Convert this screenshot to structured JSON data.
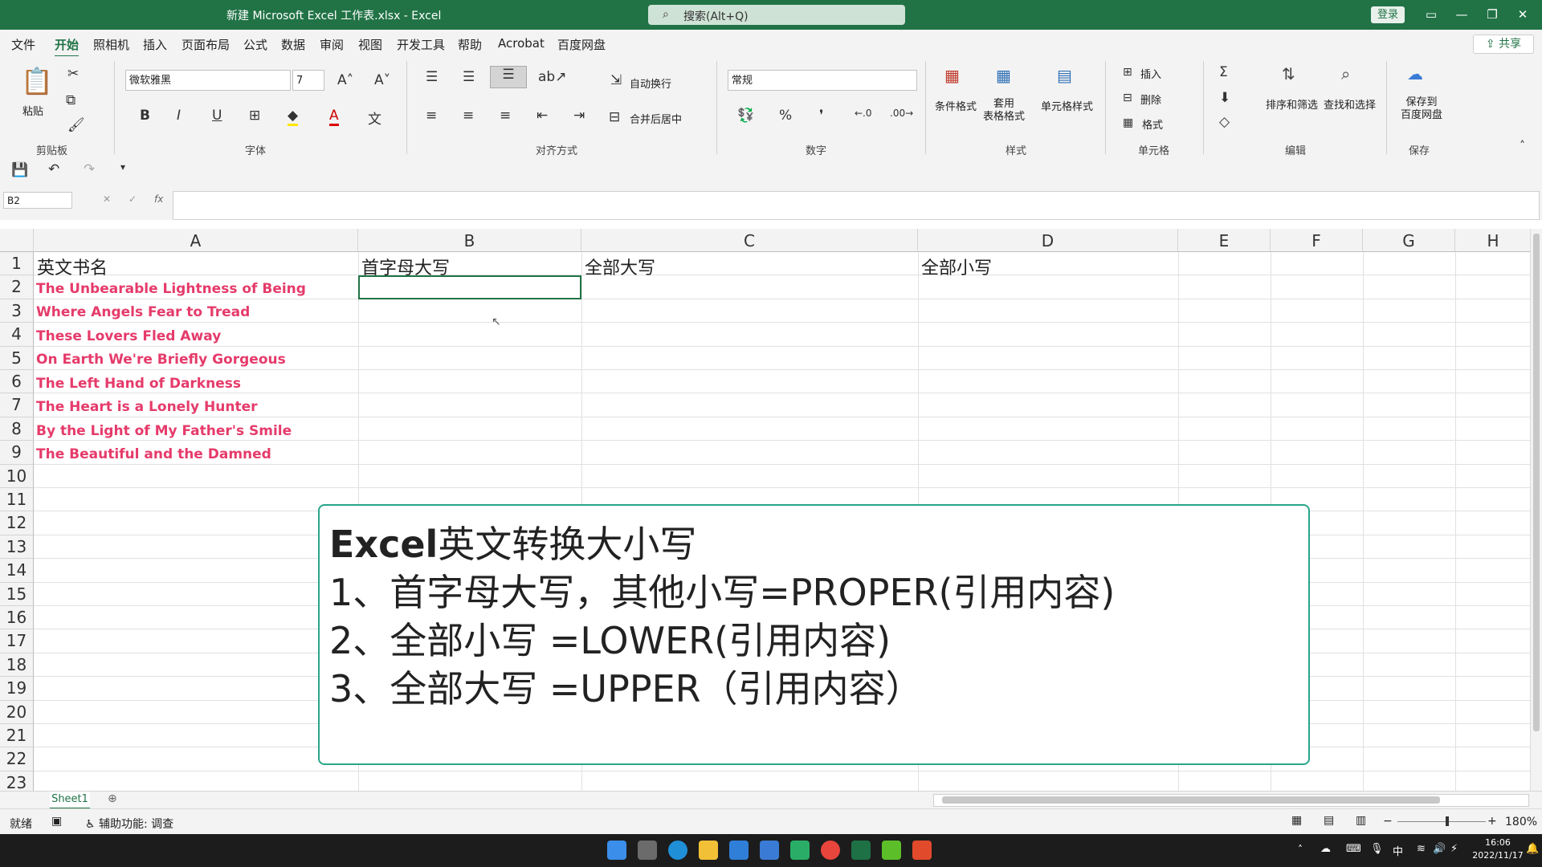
{
  "titlebar": {
    "title": "新建 Microsoft Excel 工作表.xlsx  -  Excel",
    "search_placeholder": "搜索(Alt+Q)",
    "login": "登录"
  },
  "menu": [
    "文件",
    "开始",
    "照相机",
    "插入",
    "页面布局",
    "公式",
    "数据",
    "审阅",
    "视图",
    "开发工具",
    "帮助",
    "Acrobat",
    "百度网盘"
  ],
  "share": "共享",
  "ribbon": {
    "paste": "粘贴",
    "font_name": "微软雅黑",
    "font_size": "7",
    "wrap_text": "自动换行",
    "merge_center": "合并后居中",
    "number_format": "常规",
    "cond_format": "条件格式",
    "table_format": "套用\n表格格式",
    "cell_styles": "单元格样式",
    "insert": "插入",
    "delete": "删除",
    "format": "格式",
    "sort_filter": "排序和筛选",
    "find_select": "查找和选择",
    "save_to": "保存到\n百度网盘",
    "groups": [
      "剪贴板",
      "字体",
      "对齐方式",
      "数字",
      "样式",
      "单元格",
      "编辑",
      "保存"
    ]
  },
  "name_box": "B2",
  "columns": [
    "A",
    "B",
    "C",
    "D",
    "E",
    "F",
    "G",
    "H"
  ],
  "rows": [
    "1",
    "2",
    "3",
    "4",
    "5",
    "6",
    "7",
    "8",
    "9",
    "10",
    "11",
    "12",
    "13",
    "14",
    "15",
    "16",
    "17",
    "18",
    "19",
    "20",
    "21",
    "22",
    "23"
  ],
  "headers": {
    "a1": "英文书名",
    "b1": "首字母大写",
    "c1": "全部大写",
    "d1": "全部小写"
  },
  "books": [
    "The Unbearable Lightness of Being",
    "Where Angels Fear to Tread",
    "These Lovers Fled Away",
    "On Earth We're Briefly Gorgeous",
    "The Left Hand of Darkness",
    "The Heart is a Lonely Hunter",
    "By the Light of My Father's Smile",
    "The Beautiful and the Damned"
  ],
  "note": {
    "line1_bold": "Excel",
    "line1_rest": "英文转换大小写",
    "line2": "1、首字母大写，其他小写=PROPER(引用内容)",
    "line3": "2、全部小写 =LOWER(引用内容)",
    "line4": "3、全部大写 =UPPER（引用内容）"
  },
  "sheet_tab": "Sheet1",
  "status": {
    "ready": "就绪",
    "accessibility": "辅助功能: 调查",
    "zoom": "180%"
  },
  "taskbar": {
    "ime": "中",
    "time": "16:06",
    "date": "2022/11/17"
  },
  "colors": {
    "accent": "#217346",
    "book_text": "#e53b6a",
    "note_border": "#2aa58a"
  }
}
